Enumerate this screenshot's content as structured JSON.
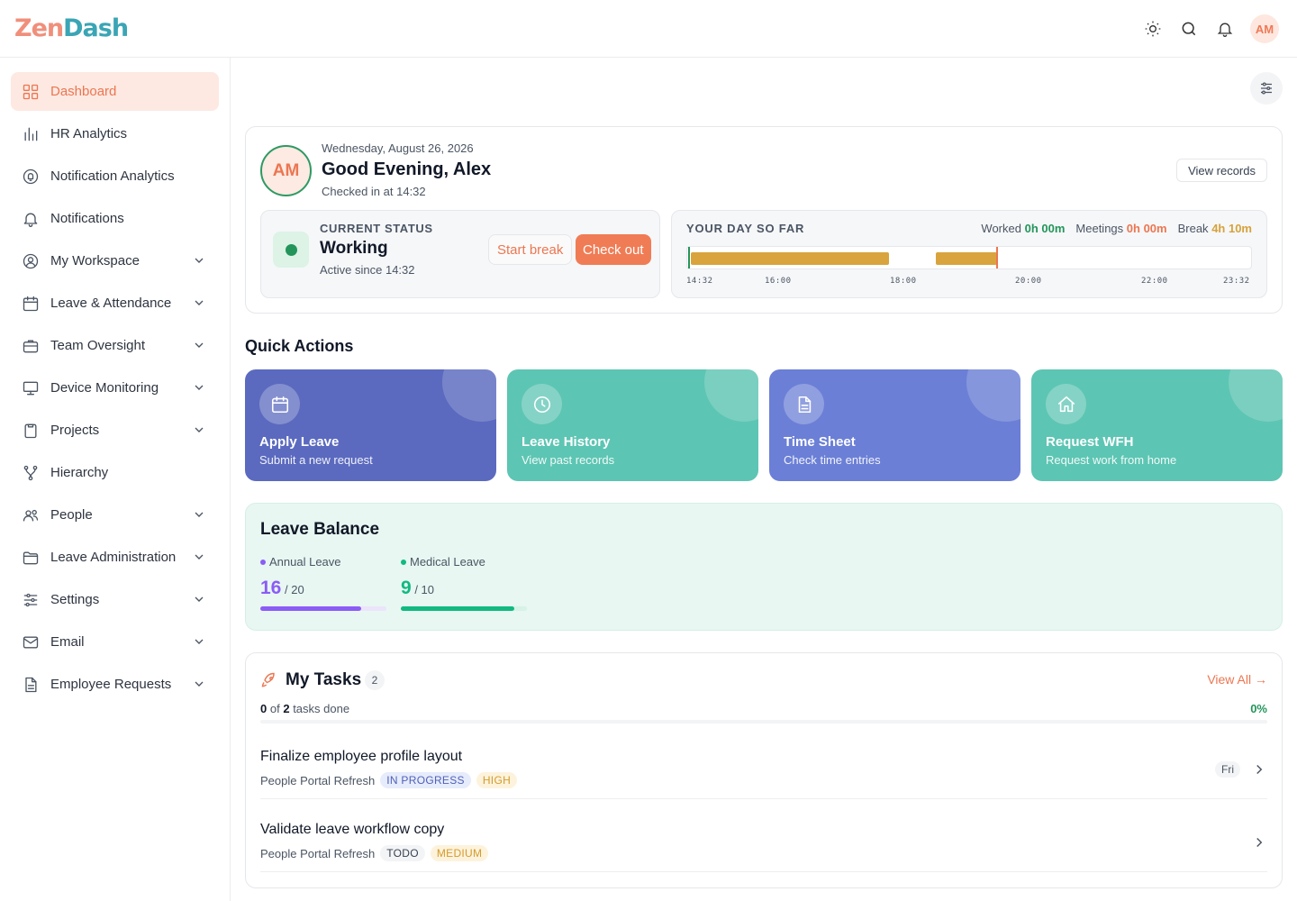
{
  "app": {
    "logo_a": "Zen",
    "logo_b": "Dash",
    "user_initials": "AM"
  },
  "colors": {
    "accent": "#ec7651",
    "green": "#23955a",
    "amber": "#d9a43d",
    "purple": "#8b5cf6",
    "teal": "#10b981"
  },
  "topbar": {
    "icons": [
      "sun-icon",
      "search-icon",
      "bell-icon"
    ]
  },
  "sidebar": {
    "items": [
      {
        "label": "Dashboard",
        "icon": "grid-icon",
        "active": true,
        "expandable": false
      },
      {
        "label": "HR Analytics",
        "icon": "bar-chart-icon",
        "expandable": false
      },
      {
        "label": "Notification Analytics",
        "icon": "bell-chart-icon",
        "expandable": false
      },
      {
        "label": "Notifications",
        "icon": "bell-icon",
        "expandable": false
      },
      {
        "label": "My Workspace",
        "icon": "user-circle-icon",
        "expandable": true
      },
      {
        "label": "Leave & Attendance",
        "icon": "calendar-icon",
        "expandable": true
      },
      {
        "label": "Team Oversight",
        "icon": "briefcase-icon",
        "expandable": true
      },
      {
        "label": "Device Monitoring",
        "icon": "monitor-icon",
        "expandable": true
      },
      {
        "label": "Projects",
        "icon": "clipboard-icon",
        "expandable": true
      },
      {
        "label": "Hierarchy",
        "icon": "hierarchy-icon",
        "expandable": false
      },
      {
        "label": "People",
        "icon": "users-icon",
        "expandable": true
      },
      {
        "label": "Leave Administration",
        "icon": "folder-icon",
        "expandable": true
      },
      {
        "label": "Settings",
        "icon": "sliders-icon",
        "expandable": true
      },
      {
        "label": "Email",
        "icon": "mail-icon",
        "expandable": true
      },
      {
        "label": "Employee Requests",
        "icon": "file-icon",
        "expandable": true
      }
    ]
  },
  "welcome": {
    "date": "Wednesday, August 26, 2026",
    "greeting": "Good Evening, Alex",
    "checked_in": "Checked in at 14:32",
    "view_records": "View records",
    "status_label": "CURRENT STATUS",
    "status_value": "Working",
    "active_since": "Active since 14:32",
    "start_break": "Start break",
    "check_out": "Check out"
  },
  "day": {
    "title": "YOUR DAY SO FAR",
    "worked_label": "Worked",
    "worked_value": "0h 00m",
    "meetings_label": "Meetings",
    "meetings_value": "0h 00m",
    "break_label": "Break",
    "break_value": "4h 10m",
    "ticks": [
      "14:32",
      "16:00",
      "18:00",
      "20:00",
      "22:00",
      "23:32"
    ]
  },
  "quick_actions": {
    "title": "Quick Actions",
    "cards": [
      {
        "name": "Apply Leave",
        "sub": "Submit a new request",
        "icon": "calendar-icon",
        "color": "#5b6abf"
      },
      {
        "name": "Leave History",
        "sub": "View past records",
        "icon": "clock-icon",
        "color": "#5dc5b3"
      },
      {
        "name": "Time Sheet",
        "sub": "Check time entries",
        "icon": "document-icon",
        "color": "#6b7fd6"
      },
      {
        "name": "Request WFH",
        "sub": "Request work from home",
        "icon": "home-icon",
        "color": "#5dc5b3"
      }
    ]
  },
  "leave_balance": {
    "title": "Leave Balance",
    "items": [
      {
        "label": "Annual Leave",
        "used": "16",
        "total": "/ 20",
        "fraction": 0.8,
        "color": "#8b5cf6",
        "track": "#ece4fb"
      },
      {
        "label": "Medical Leave",
        "used": "9",
        "total": "/ 10",
        "fraction": 0.9,
        "color": "#10b981",
        "track": "#d5f3e6"
      }
    ]
  },
  "tasks": {
    "title": "My Tasks",
    "count": "2",
    "view_all": "View All →",
    "done": "0",
    "of_label": "of",
    "total": "2",
    "done_suffix": "tasks done",
    "percent": "0%",
    "items": [
      {
        "name": "Finalize employee profile layout",
        "project": "People Portal Refresh",
        "status": "IN PROGRESS",
        "priority": "HIGH",
        "due": "Fri"
      },
      {
        "name": "Validate leave workflow copy",
        "project": "People Portal Refresh",
        "status": "TODO",
        "priority": "MEDIUM",
        "due": ""
      }
    ]
  }
}
